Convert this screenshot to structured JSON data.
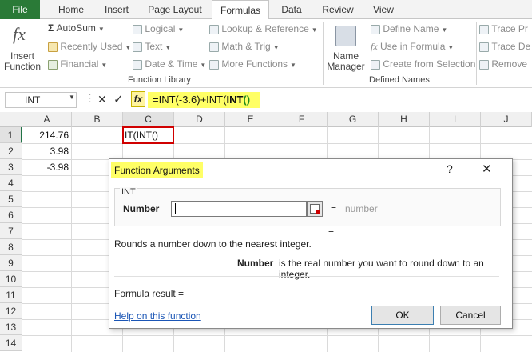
{
  "tabs": [
    "File",
    "Home",
    "Insert",
    "Page Layout",
    "Formulas",
    "Data",
    "Review",
    "View"
  ],
  "ribbon": {
    "insert_function": [
      "Insert",
      "Function"
    ],
    "autosum": "AutoSum",
    "recently_used": "Recently Used",
    "financial": "Financial",
    "logical": "Logical",
    "text": "Text",
    "date_time": "Date & Time",
    "lookup_reference": "Lookup & Reference",
    "math_trig": "Math & Trig",
    "more_functions": "More Functions",
    "function_library": "Function Library",
    "name_manager": [
      "Name",
      "Manager"
    ],
    "define_name": "Define Name",
    "use_in_formula": "Use in Formula",
    "create_from_selection": "Create from Selection",
    "defined_names": "Defined Names",
    "trace_precedents": "Trace Pr",
    "trace_dependents": "Trace De",
    "remove_arrows": "Remove"
  },
  "formula_bar": {
    "name_box": "INT",
    "fx": "fx",
    "formula_prefix": "=INT(-3.6)+INT(",
    "formula_bold": "INT",
    "formula_suffix": "()"
  },
  "sheet": {
    "columns": [
      "A",
      "B",
      "C",
      "D",
      "E",
      "F",
      "G",
      "H",
      "I",
      "J"
    ],
    "rows": [
      "1",
      "2",
      "3",
      "4",
      "5",
      "6",
      "7",
      "8",
      "9",
      "10",
      "11",
      "12",
      "13",
      "14"
    ],
    "a1": "214.76",
    "a2": "3.98",
    "a3": "-3.98",
    "c1": "IT(INT()"
  },
  "dialog": {
    "title": "Function Arguments",
    "help_glyph": "?",
    "close_glyph": "✕",
    "function_name": "INT",
    "arg_label": "Number",
    "arg_value": "",
    "arg_equals": "=",
    "arg_result": "number",
    "result_equals": "=",
    "description": "Rounds a number down to the nearest integer.",
    "arg_desc_label": "Number",
    "arg_desc": "is the real number you want to round down to an integer.",
    "formula_result": "Formula result =",
    "help_link": "Help on this function",
    "ok": "OK",
    "cancel": "Cancel"
  },
  "colors": {
    "file_tab": "#2a7a37",
    "highlight": "#ffff66",
    "selected_cell_border": "#d00000",
    "link": "#1a55b5"
  }
}
